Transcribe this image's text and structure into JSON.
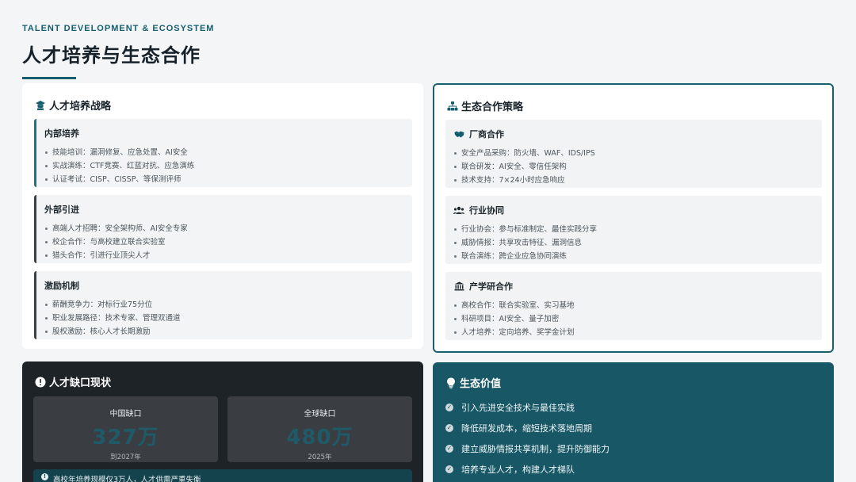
{
  "header": {
    "eyebrow": "TALENT DEVELOPMENT & ECOSYSTEM",
    "title": "人才培养与生态合作"
  },
  "talent": {
    "icon": "graduate-icon",
    "title": "人才培养战略",
    "blocks": [
      {
        "title": "内部培养",
        "items": [
          "技能培训：漏洞修复、应急处置、AI安全",
          "实战演练：CTF竞赛、红蓝对抗、应急演练",
          "认证考试：CISP、CISSP、等保测评师"
        ]
      },
      {
        "title": "外部引进",
        "items": [
          "高端人才招聘：安全架构师、AI安全专家",
          "校企合作：与高校建立联合实验室",
          "猎头合作：引进行业顶尖人才"
        ]
      },
      {
        "title": "激励机制",
        "items": [
          "薪酬竞争力：对标行业75分位",
          "职业发展路径：技术专家、管理双通道",
          "股权激励：核心人才长期激励"
        ]
      }
    ]
  },
  "ecosystem": {
    "icon": "network-icon",
    "title": "生态合作策略",
    "blocks": [
      {
        "icon": "handshake-icon",
        "title": "厂商合作",
        "items": [
          "安全产品采购：防火墙、WAF、IDS/IPS",
          "联合研发：AI安全、零信任架构",
          "技术支持：7×24小时应急响应"
        ]
      },
      {
        "icon": "users-icon",
        "title": "行业协同",
        "items": [
          "行业协会：参与标准制定、最佳实践分享",
          "威胁情报：共享攻击特征、漏洞信息",
          "联合演练：跨企业应急协同演练"
        ]
      },
      {
        "icon": "institution-icon",
        "title": "产学研合作",
        "items": [
          "高校合作：联合实验室、实习基地",
          "科研项目：AI安全、量子加密",
          "人才培养：定向培养、奖学金计划"
        ]
      }
    ]
  },
  "gap": {
    "icon": "alert-icon",
    "title": "人才缺口现状",
    "stats": [
      {
        "label": "中国缺口",
        "value": "327万",
        "sub": "到2027年"
      },
      {
        "label": "全球缺口",
        "value": "480万",
        "sub": "2025年"
      }
    ],
    "note": "高校年培养规模仅3万人，人才供需严重失衡"
  },
  "value": {
    "icon": "lightbulb-icon",
    "title": "生态价值",
    "items": [
      "引入先进安全技术与最佳实践",
      "降低研发成本，缩短技术落地周期",
      "建立威胁情报共享机制，提升防御能力",
      "培养专业人才，构建人才梯队"
    ]
  },
  "colors": {
    "accent": "#155e6e",
    "dark_panel": "#1e2327",
    "teal_panel": "#175766"
  }
}
